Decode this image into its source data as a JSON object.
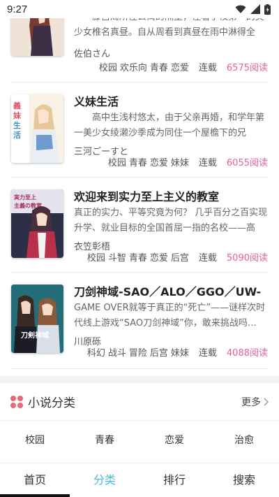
{
  "status_bar": {
    "time": "9:27"
  },
  "books": [
    {
      "title": "",
      "desc": "籐宫周所住公寓的隔壁，住着学校第一的美少女椎名真昼。自从周看到真昼在雨中淋得全身…",
      "author": "佐伯さん",
      "tags": [
        "校园",
        "欢乐向",
        "青春",
        "恋爱"
      ],
      "status": "连载",
      "reads": "6575阅读"
    },
    {
      "title": "义妹生活",
      "desc": "高中生浅村悠太，由于父亲再婚，和学年第一美少女绫濑沙季成为同住一个屋檐下的兄妹。…",
      "author": "三河ごーすと",
      "tags": [
        "校园",
        "青春",
        "恋爱",
        "妹妹"
      ],
      "status": "连载",
      "reads": "6055阅读"
    },
    {
      "title": "欢迎来到实力至上主义的教室",
      "desc": "真正的实力、平等究竟为何？ 几乎百分之百实现升学、就业目标的全国首屈一指的名校——高度…",
      "author": "衣笠彰梧",
      "tags": [
        "校园",
        "斗智",
        "青春",
        "恋爱",
        "后宫"
      ],
      "status": "连载",
      "reads": "5090阅读"
    },
    {
      "title": "刀剑神域-SAO／ALO／GGO／UW-",
      "desc": "GAME OVER就等于真正的“死亡”——谜样次时代线上游戏“SAO刀剑神域”你，敢来挑战吗…",
      "author": "川原砾",
      "tags": [
        "科幻",
        "战斗",
        "冒险",
        "后宫",
        "妹妹"
      ],
      "status": "连载",
      "reads": "4088阅读"
    }
  ],
  "category_section": {
    "title": "小说分类",
    "more": "更多",
    "items": [
      "校园",
      "青春",
      "恋爱",
      "治愈"
    ]
  },
  "tabbar": {
    "items": [
      "首页",
      "分类",
      "排行",
      "搜索"
    ],
    "active": "分类",
    "active_color": "#4ab9d8"
  },
  "colors": {
    "reads": "#e8609a",
    "category_icon": "#e8677a"
  }
}
